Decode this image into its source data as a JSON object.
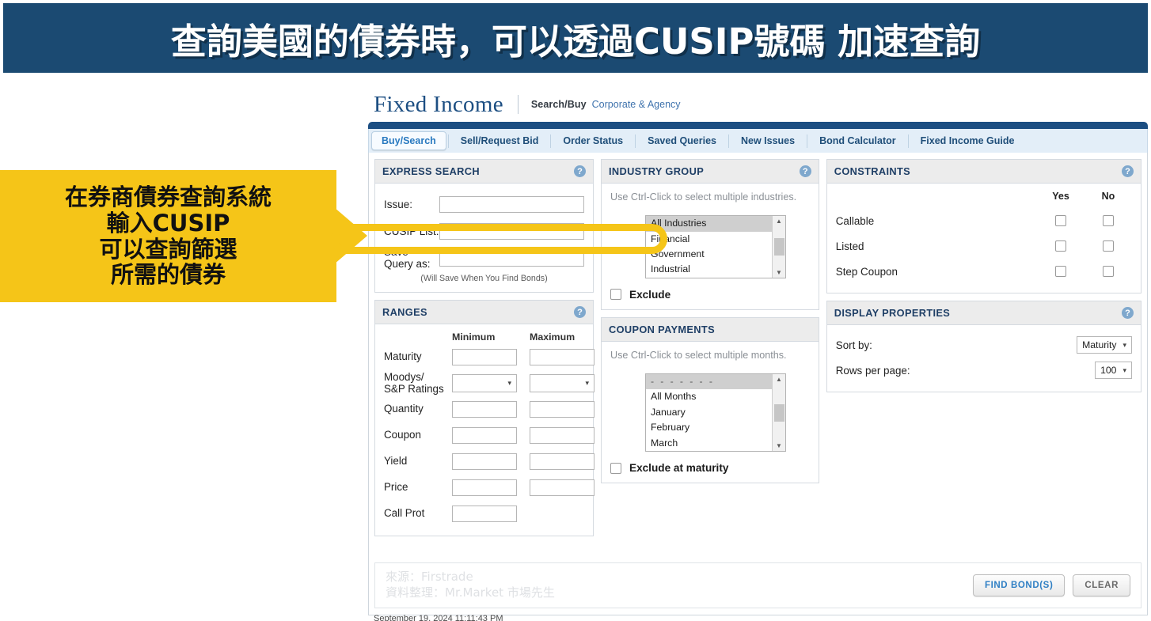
{
  "banner": {
    "text": "查詢美國的債券時，可以透過CUSIP號碼 加速查詢",
    "bg": "#1b4a72",
    "fg": "#ffffff"
  },
  "callout": {
    "bg": "#f5c518",
    "lines": [
      "在券商債券查詢系統",
      "輸入CUSIP",
      "可以查詢篩選",
      "所需的債券"
    ]
  },
  "app": {
    "title": "Fixed Income",
    "subtitle_strong": "Search/Buy",
    "subtitle_light": "Corporate & Agency",
    "accent": "#1c4e82",
    "tabs": [
      {
        "label": "Buy/Search",
        "active": true
      },
      {
        "label": "Sell/Request Bid",
        "active": false
      },
      {
        "label": "Order Status",
        "active": false
      },
      {
        "label": "Saved Queries",
        "active": false
      },
      {
        "label": "New Issues",
        "active": false
      },
      {
        "label": "Bond Calculator",
        "active": false
      },
      {
        "label": "Fixed Income Guide",
        "active": false
      }
    ]
  },
  "express_search": {
    "title": "EXPRESS SEARCH",
    "help": "?",
    "fields": [
      {
        "label": "Issue:",
        "value": "",
        "placeholder": ""
      },
      {
        "label": "CUSIP List:",
        "value": "",
        "placeholder": ""
      },
      {
        "label": "Save Query as:",
        "value": "",
        "placeholder": ""
      }
    ],
    "hint": "(Will Save When You Find Bonds)"
  },
  "ranges": {
    "title": "RANGES",
    "help": "?",
    "col_min": "Minimum",
    "col_max": "Maximum",
    "rows": [
      {
        "label": "Maturity",
        "type": "text",
        "min": "",
        "max": "",
        "has_max": true
      },
      {
        "label": "Moodys/\nS&P Ratings",
        "label_line1": "Moodys/",
        "label_line2": "S&P Ratings",
        "type": "select",
        "min": "",
        "max": "",
        "has_max": true
      },
      {
        "label": "Quantity",
        "type": "text",
        "min": "",
        "max": "",
        "has_max": true
      },
      {
        "label": "Coupon",
        "type": "text",
        "min": "",
        "max": "",
        "has_max": true
      },
      {
        "label": "Yield",
        "type": "text",
        "min": "",
        "max": "",
        "has_max": true
      },
      {
        "label": "Price",
        "type": "text",
        "min": "",
        "max": "",
        "has_max": true
      },
      {
        "label": "Call Prot",
        "type": "text",
        "min": "",
        "max": "",
        "has_max": false
      }
    ]
  },
  "industry_group": {
    "title": "INDUSTRY GROUP",
    "help": "?",
    "note": "Use Ctrl-Click to select multiple industries.",
    "options": [
      {
        "label": "All Industries",
        "selected": true
      },
      {
        "label": "Financial",
        "selected": false
      },
      {
        "label": "Government",
        "selected": false
      },
      {
        "label": "Industrial",
        "selected": false
      }
    ],
    "exclude_label": "Exclude",
    "exclude_checked": false
  },
  "coupon_payments": {
    "title": "COUPON PAYMENTS",
    "note": "Use Ctrl-Click to select multiple months.",
    "options": [
      {
        "label": "- - - - - - -",
        "selected": true,
        "dash": true
      },
      {
        "label": "All Months",
        "selected": false
      },
      {
        "label": "January",
        "selected": false
      },
      {
        "label": "February",
        "selected": false
      },
      {
        "label": "March",
        "selected": false
      }
    ],
    "exclude_label": "Exclude at maturity",
    "exclude_checked": false
  },
  "constraints": {
    "title": "CONSTRAINTS",
    "help": "?",
    "col_yes": "Yes",
    "col_no": "No",
    "rows": [
      {
        "label": "Callable",
        "yes": false,
        "no": false
      },
      {
        "label": "Listed",
        "yes": false,
        "no": false
      },
      {
        "label": "Step Coupon",
        "yes": false,
        "no": false
      }
    ]
  },
  "display_properties": {
    "title": "DISPLAY PROPERTIES",
    "help": "?",
    "sort_by_label": "Sort by:",
    "sort_by_value": "Maturity",
    "rows_per_page_label": "Rows per page:",
    "rows_per_page_value": "100"
  },
  "footer": {
    "watermark_line1": "來源：Firstrade",
    "watermark_line2": "資料整理：Mr.Market 市場先生",
    "find_label": "FIND BOND(S)",
    "clear_label": "CLEAR",
    "find_color": "#2f7fc4"
  },
  "timestamp": "September 19, 2024 11:11:43 PM"
}
